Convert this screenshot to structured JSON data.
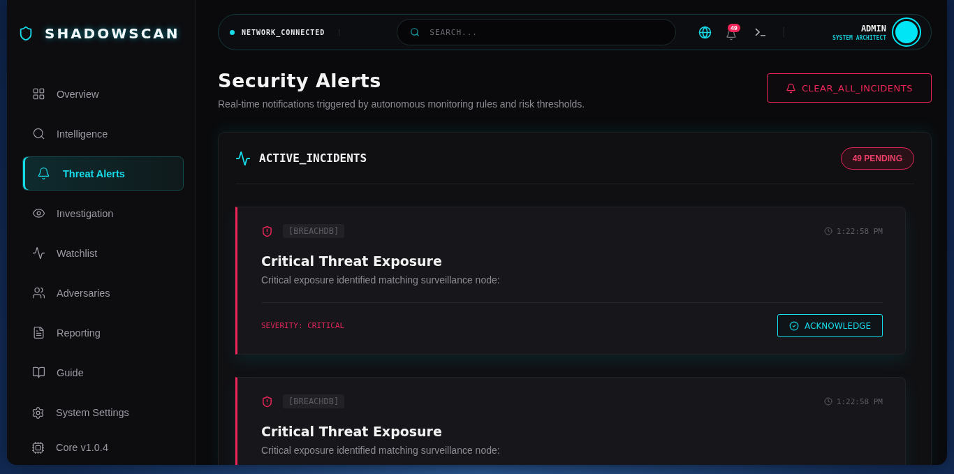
{
  "brand": {
    "name": "SHADOWSCAN"
  },
  "sidebar": {
    "items": [
      {
        "label": "Overview",
        "selected": false
      },
      {
        "label": "Intelligence",
        "selected": false
      },
      {
        "label": "Threat Alerts",
        "selected": true
      },
      {
        "label": "Investigation",
        "selected": false
      },
      {
        "label": "Watchlist",
        "selected": false
      },
      {
        "label": "Adversaries",
        "selected": false
      },
      {
        "label": "Reporting",
        "selected": false
      },
      {
        "label": "Guide",
        "selected": false
      }
    ],
    "footer": [
      {
        "label": "System Settings"
      },
      {
        "label": "Core v1.0.4"
      }
    ]
  },
  "topbar": {
    "status": "NETWORK_CONNECTED",
    "search": {
      "placeholder": "SEARCH..."
    },
    "notification_count": "49",
    "user": {
      "name": "ADMIN",
      "role": "SYSTEM ARCHITECT"
    }
  },
  "header": {
    "title": "Security Alerts",
    "subtitle": "Real-time notifications triggered by autonomous monitoring rules and risk thresholds.",
    "action": "CLEAR_ALL_INCIDENTS"
  },
  "panel": {
    "title": "ACTIVE_INCIDENTS",
    "badge": "49 PENDING",
    "alerts": [
      {
        "source": "[BREACHDB]",
        "time": "1:22:58 PM",
        "title": "Critical Threat Exposure",
        "description": "Critical exposure identified matching surveillance node:",
        "severity": "SEVERITY: CRITICAL",
        "action": "ACKNOWLEDGE"
      },
      {
        "source": "[BREACHDB]",
        "time": "1:22:58 PM",
        "title": "Critical Threat Exposure",
        "description": "Critical exposure identified matching surveillance node:"
      }
    ]
  }
}
